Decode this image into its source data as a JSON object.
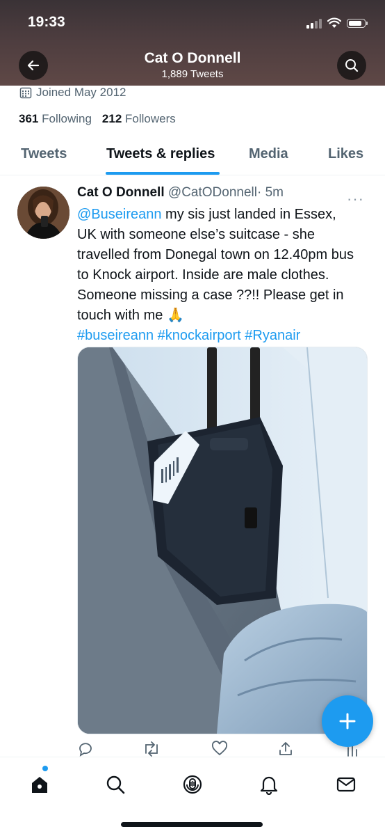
{
  "status_bar": {
    "time": "19:33",
    "battery_level": 0.85
  },
  "header": {
    "name": "Cat O Donnell",
    "tweet_count": "1,889 Tweets",
    "back_icon": "arrow-left-icon",
    "search_icon": "search-icon"
  },
  "profile": {
    "joined": "Joined May 2012",
    "following_count": "361",
    "following_label": "Following",
    "followers_count": "212",
    "followers_label": "Followers"
  },
  "tabs": [
    {
      "label": "Tweets",
      "active": false
    },
    {
      "label": "Tweets & replies",
      "active": true
    },
    {
      "label": "Media",
      "active": false
    },
    {
      "label": "Likes",
      "active": false
    }
  ],
  "tweet": {
    "author_name": "Cat O Donnell",
    "handle": "@CatODonnell",
    "separator": "·",
    "time": "5m",
    "mention": "@Buseireann",
    "body_line1": " my sis just landed in Essex,",
    "body_rest": "UK with someone else’s suitcase - she travelled from Donegal town on 12.40pm bus to Knock airport. Inside are male clothes. Someone missing a case ??!! Please get in touch with me 🙏",
    "hashtags": [
      "#buseireann",
      "#knockairport",
      "#Ryanair"
    ],
    "media_alt": "suitcase-photo"
  },
  "colors": {
    "accent": "#1d9bf0",
    "text": "#0f1419",
    "muted": "#536471",
    "header_bg": "#4d3d3f"
  }
}
